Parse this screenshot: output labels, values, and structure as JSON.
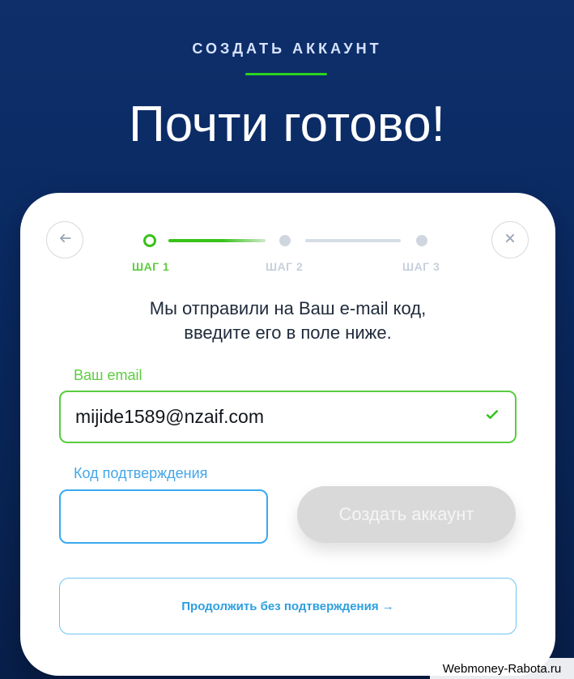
{
  "hero": {
    "kicker": "СОЗДАТЬ АККАУНТ",
    "title": "Почти готово!"
  },
  "steps": [
    {
      "label": "ШАГ 1",
      "state": "active"
    },
    {
      "label": "ШАГ 2",
      "state": "inactive"
    },
    {
      "label": "ШАГ 3",
      "state": "inactive"
    }
  ],
  "card": {
    "back_icon": "arrow-left-icon",
    "close_icon": "close-icon",
    "instructions": [
      "Мы отправили на Ваш e-mail код,",
      "введите его в поле ниже."
    ],
    "email": {
      "label": "Ваш email",
      "value": "mijide1589@nzaif.com",
      "status_icon": "check-icon"
    },
    "code": {
      "label": "Код подтверждения",
      "value": "",
      "placeholder": ""
    },
    "create_button": "Создать аккаунт",
    "continue_link": "Продолжить без подтверждения →"
  },
  "watermark": "Webmoney-Rabota.ru",
  "colors": {
    "accent_green": "#38c21a",
    "accent_blue": "#3aa9f0",
    "background": "#0f2f6b"
  }
}
